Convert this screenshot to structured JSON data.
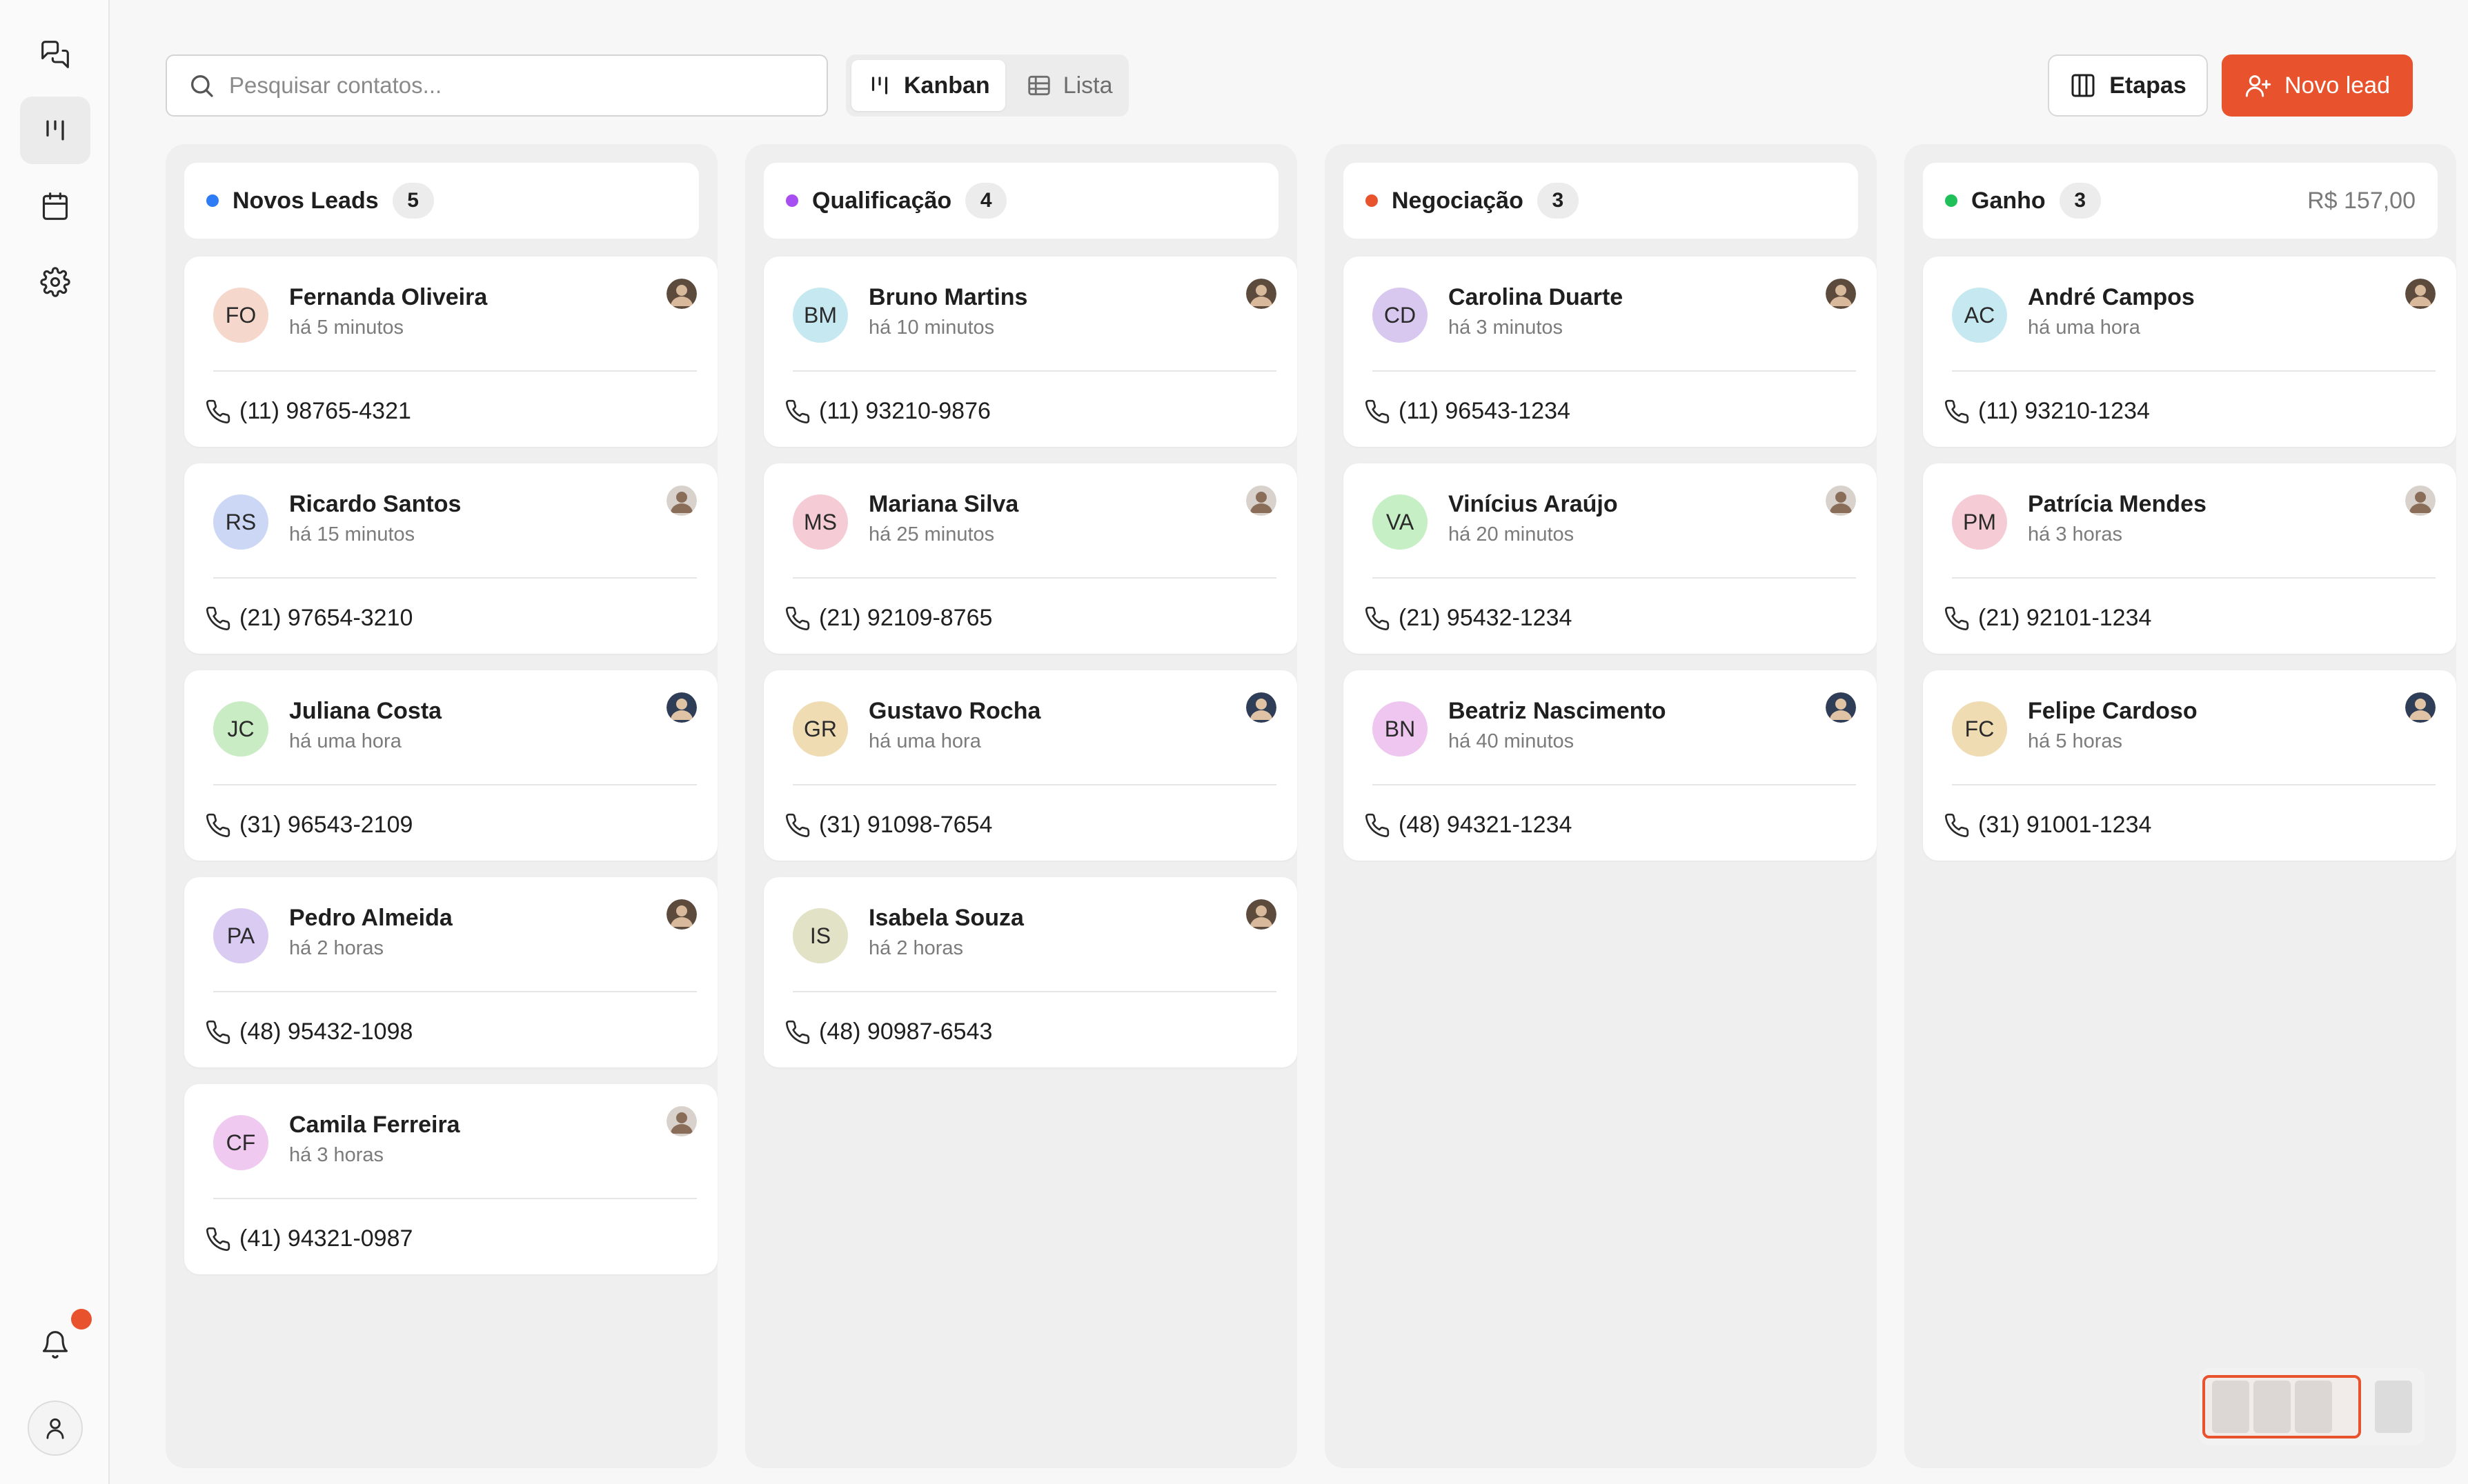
{
  "sidebar": {
    "items": [
      {
        "icon": "chat-icon",
        "active": false
      },
      {
        "icon": "kanban-icon",
        "active": true
      },
      {
        "icon": "calendar-icon",
        "active": false
      },
      {
        "icon": "gear-icon",
        "active": false
      }
    ],
    "notification_icon": "bell-icon",
    "user_icon": "user-icon"
  },
  "search": {
    "placeholder": "Pesquisar contatos..."
  },
  "view_toggle": {
    "kanban_label": "Kanban",
    "lista_label": "Lista",
    "selected": "Kanban"
  },
  "actions": {
    "etapas_label": "Etapas",
    "novo_lead_label": "Novo lead"
  },
  "colors": {
    "accent": "#e8532d"
  },
  "columns": [
    {
      "title": "Novos Leads",
      "count": "5",
      "total": "",
      "color": "#2e7bf6",
      "cards": [
        {
          "initials": "FO",
          "name": "Fernanda Oliveira",
          "time": "há 5 minutos",
          "phone": "(11) 98765-4321",
          "avatar_bg": "#f6d7cc"
        },
        {
          "initials": "RS",
          "name": "Ricardo Santos",
          "time": "há 15 minutos",
          "phone": "(21) 97654-3210",
          "avatar_bg": "#cbd7f5"
        },
        {
          "initials": "JC",
          "name": "Juliana Costa",
          "time": "há uma hora",
          "phone": "(31) 96543-2109",
          "avatar_bg": "#c9ecc4"
        },
        {
          "initials": "PA",
          "name": "Pedro Almeida",
          "time": "há 2 horas",
          "phone": "(48) 95432-1098",
          "avatar_bg": "#d9cbf1"
        },
        {
          "initials": "CF",
          "name": "Camila Ferreira",
          "time": "há 3 horas",
          "phone": "(41) 94321-0987",
          "avatar_bg": "#efc9ef"
        }
      ]
    },
    {
      "title": "Qualificação",
      "count": "4",
      "total": "",
      "color": "#a64ef2",
      "cards": [
        {
          "initials": "BM",
          "name": "Bruno Martins",
          "time": "há 10 minutos",
          "phone": "(11) 93210-9876",
          "avatar_bg": "#c6e9f1"
        },
        {
          "initials": "MS",
          "name": "Mariana Silva",
          "time": "há 25 minutos",
          "phone": "(21) 92109-8765",
          "avatar_bg": "#f5cbd5"
        },
        {
          "initials": "GR",
          "name": "Gustavo Rocha",
          "time": "há uma hora",
          "phone": "(31) 91098-7654",
          "avatar_bg": "#efdcb2"
        },
        {
          "initials": "IS",
          "name": "Isabela Souza",
          "time": "há 2 horas",
          "phone": "(48) 90987-6543",
          "avatar_bg": "#e2e2c6"
        }
      ]
    },
    {
      "title": "Negociação",
      "count": "3",
      "total": "",
      "color": "#e8532d",
      "cards": [
        {
          "initials": "CD",
          "name": "Carolina Duarte",
          "time": "há 3 minutos",
          "phone": "(11) 96543-1234",
          "avatar_bg": "#d8c8f0"
        },
        {
          "initials": "VA",
          "name": "Vinícius Araújo",
          "time": "há 20 minutos",
          "phone": "(21) 95432-1234",
          "avatar_bg": "#c6efc6"
        },
        {
          "initials": "BN",
          "name": "Beatriz Nascimento",
          "time": "há 40 minutos",
          "phone": "(48) 94321-1234",
          "avatar_bg": "#eec6ef"
        }
      ]
    },
    {
      "title": "Ganho",
      "count": "3",
      "total": "R$ 157,00",
      "color": "#1fbf5a",
      "cards": [
        {
          "initials": "AC",
          "name": "André Campos",
          "time": "há uma hora",
          "phone": "(11) 93210-1234",
          "avatar_bg": "#c6e9f1"
        },
        {
          "initials": "PM",
          "name": "Patrícia Mendes",
          "time": "há 3 horas",
          "phone": "(21) 92101-1234",
          "avatar_bg": "#f5cbd5"
        },
        {
          "initials": "FC",
          "name": "Felipe Cardoso",
          "time": "há 5 horas",
          "phone": "(31) 91001-1234",
          "avatar_bg": "#efdcb2"
        }
      ]
    }
  ]
}
